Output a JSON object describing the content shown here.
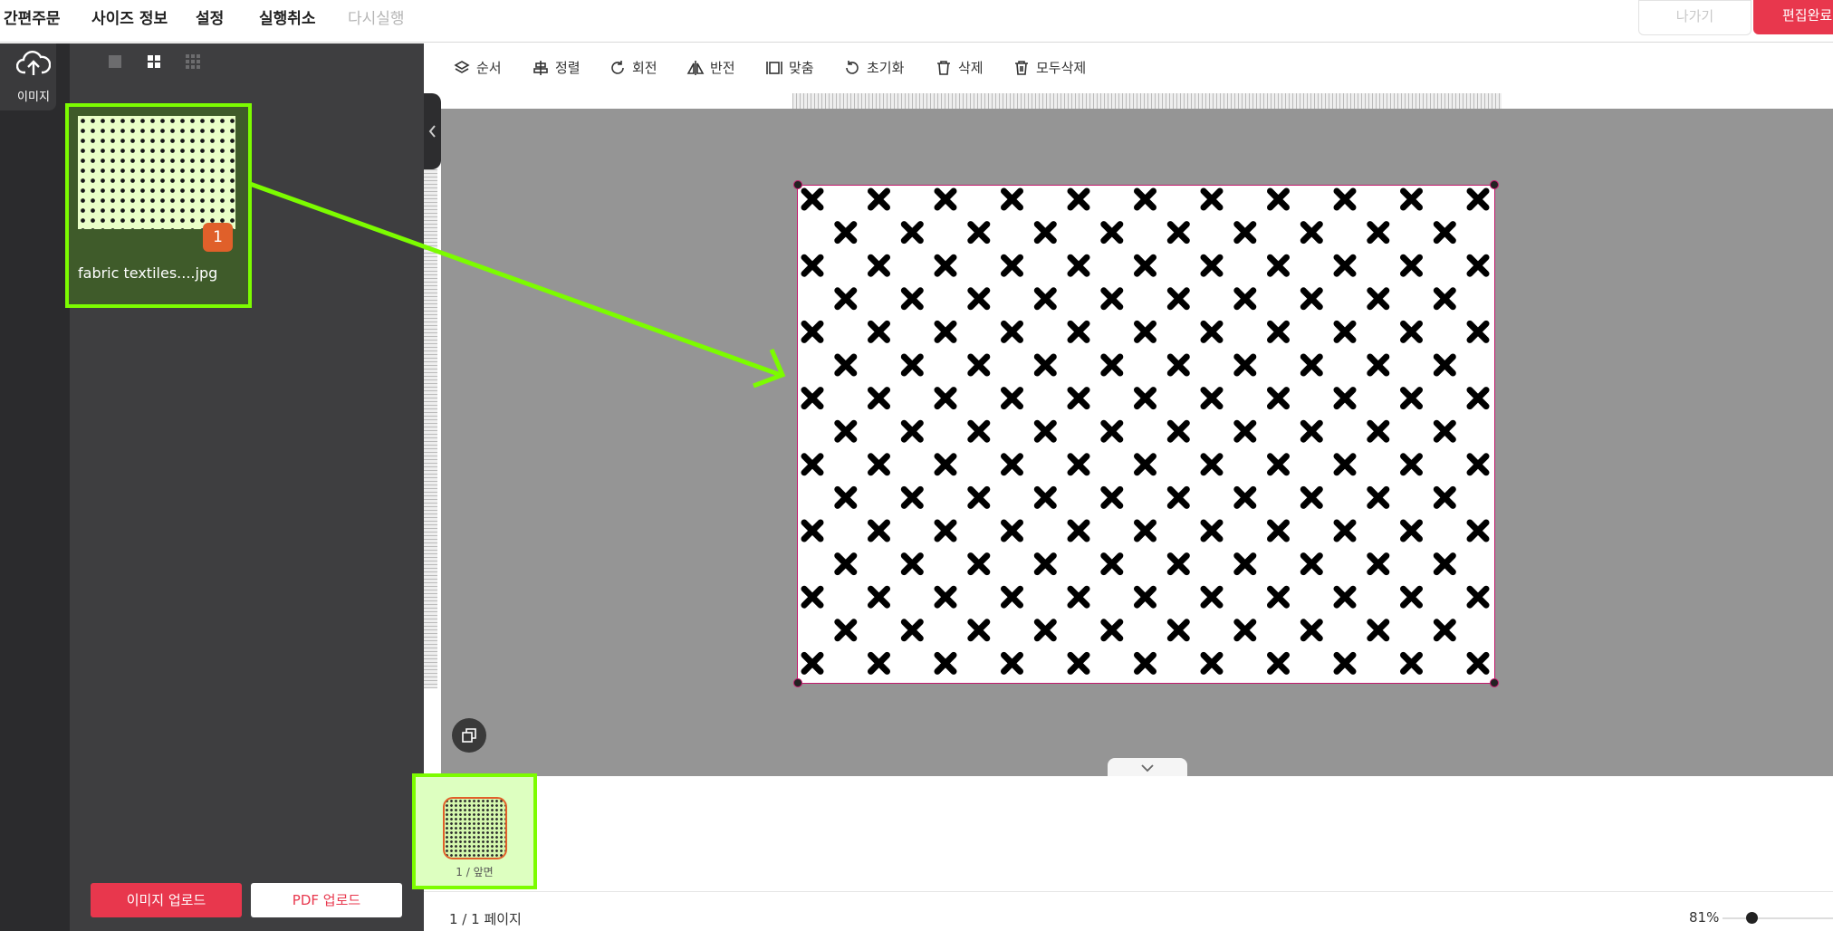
{
  "topbar": {
    "menu": [
      "간편주문",
      "사이즈 정보",
      "설정",
      "실행취소",
      "다시실행"
    ],
    "exit_label": "나가기",
    "done_label": "편집완료"
  },
  "rail": {
    "image_label": "이미지"
  },
  "panel": {
    "thumb_name": "fabric textiles....jpg",
    "thumb_badge": "1",
    "upload_image_label": "이미지 업로드",
    "upload_pdf_label": "PDF 업로드"
  },
  "toolbar": {
    "items": [
      "순서",
      "정렬",
      "회전",
      "반전",
      "맞춤",
      "초기화",
      "삭제",
      "모두삭제"
    ]
  },
  "pages": {
    "thumb_label": "1 / 앞면",
    "pager": "1 / 1 페이지",
    "zoom": "81%"
  },
  "colors": {
    "accent": "#e8374d",
    "highlight": "#7cfc00",
    "badge": "#e0602a",
    "selection": "#c2186b"
  }
}
